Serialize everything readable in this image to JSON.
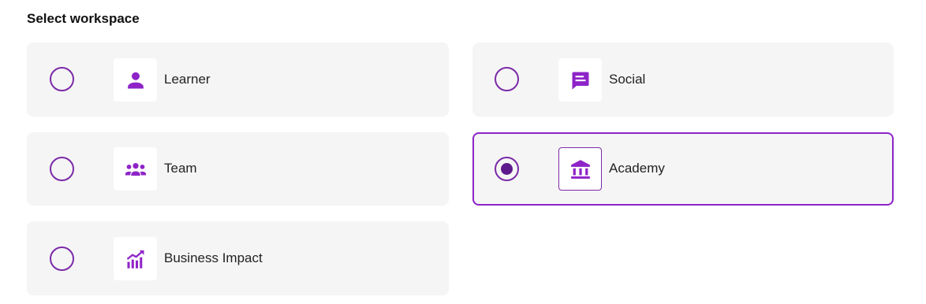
{
  "heading": "Select workspace",
  "accent_color": "#8e24c8",
  "options": [
    {
      "label": "Learner",
      "icon": "person-icon",
      "selected": false
    },
    {
      "label": "Social",
      "icon": "chat-icon",
      "selected": false
    },
    {
      "label": "Team",
      "icon": "group-icon",
      "selected": false
    },
    {
      "label": "Academy",
      "icon": "institution-icon",
      "selected": true
    },
    {
      "label": "Business Impact",
      "icon": "chart-trend-icon",
      "selected": false
    }
  ]
}
